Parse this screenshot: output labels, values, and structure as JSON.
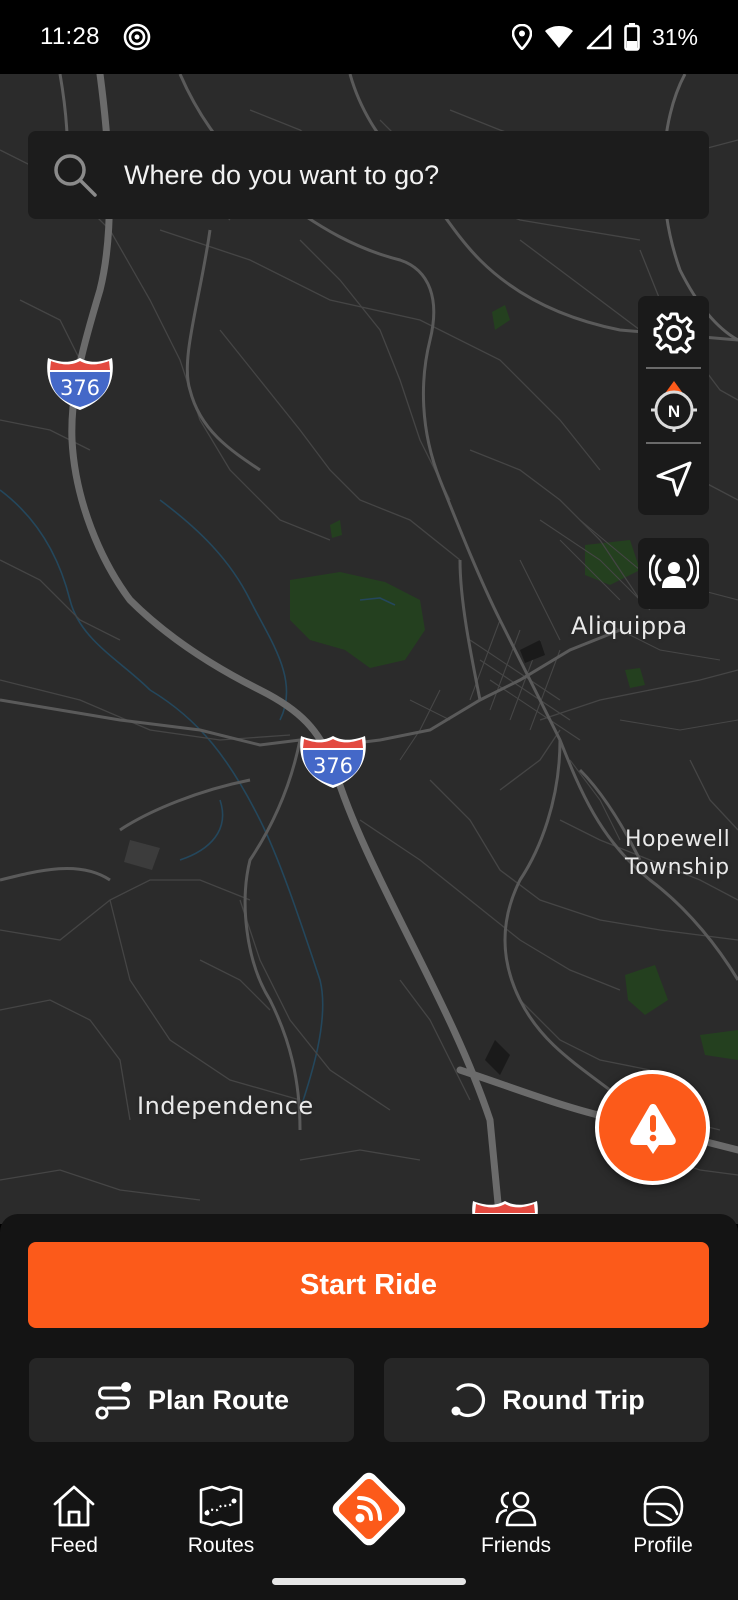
{
  "status_bar": {
    "time": "11:28",
    "battery": "31%",
    "icons": [
      "hotspot-icon",
      "location-icon",
      "wifi-icon",
      "signal-icon",
      "battery-icon"
    ]
  },
  "search": {
    "placeholder": "Where do you want to go?",
    "icon": "search-icon"
  },
  "map": {
    "labels": {
      "aliquippa": "Aliquippa",
      "hopewell": "Hopewell Township",
      "hopewell_line1": "Hopewell",
      "hopewell_line2": "Township",
      "independence": "Independence"
    },
    "highway_shields": [
      {
        "route": "376"
      },
      {
        "route": "376"
      }
    ],
    "controls": [
      "gear-icon",
      "compass-icon",
      "navigate-arrow-icon"
    ],
    "compass_letter": "N",
    "broadcast_icon": "broadcast-person-icon",
    "hazard_icon": "hazard-alert-icon"
  },
  "actions": {
    "start_ride": "Start Ride",
    "plan_route": "Plan Route",
    "round_trip": "Round Trip"
  },
  "bottom_nav": {
    "items": [
      {
        "label": "Feed",
        "icon": "home-icon"
      },
      {
        "label": "Routes",
        "icon": "map-icon"
      },
      {
        "label": "",
        "icon": "app-logo-icon"
      },
      {
        "label": "Friends",
        "icon": "friends-icon"
      },
      {
        "label": "Profile",
        "icon": "helmet-icon"
      }
    ]
  },
  "colors": {
    "accent": "#fc5a1a",
    "map_background": "#2b2b2b",
    "panel": "#141414",
    "button_secondary": "#262626",
    "interstate_blue": "#4468c8",
    "interstate_red": "#e34a40",
    "park_green": "#24401f"
  }
}
